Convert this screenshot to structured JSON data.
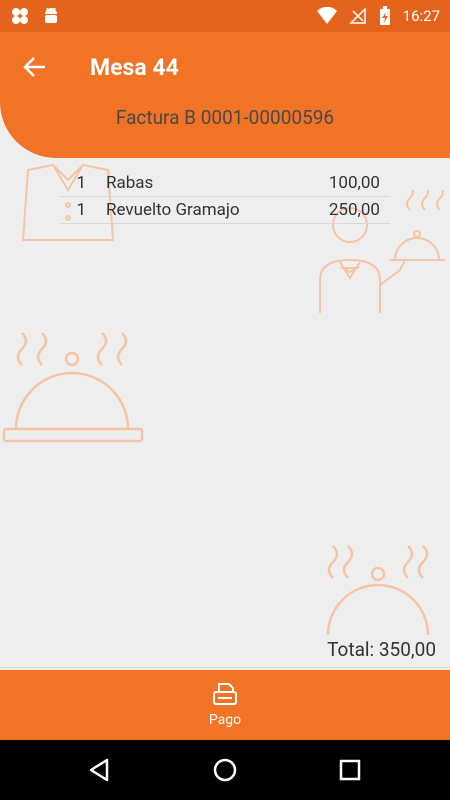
{
  "status_bar": {
    "time": "16:27",
    "icons": [
      "clover-icon",
      "android-icon",
      "wifi-icon",
      "no-signal-icon",
      "battery-charging-icon"
    ]
  },
  "app_bar": {
    "title": "Mesa 44",
    "subtitle": "Factura B 0001-00000596",
    "back_icon": "arrow-back-icon"
  },
  "items": [
    {
      "qty": "1",
      "name": "Rabas",
      "amount": "100,00"
    },
    {
      "qty": "1",
      "name": "Revuelto Gramajo",
      "amount": "250,00"
    }
  ],
  "total_label": "Total: 350,00",
  "bottom_bar": {
    "pago_label": "Pago",
    "pago_icon": "printer-icon"
  },
  "nav_bar": {
    "icons": [
      "back-triangle-icon",
      "home-circle-icon",
      "recents-square-icon"
    ]
  },
  "colors": {
    "primary": "#f07326",
    "primary_dark": "#e4641d",
    "background": "#eeeeee",
    "illustration": "#f5c4a6"
  }
}
